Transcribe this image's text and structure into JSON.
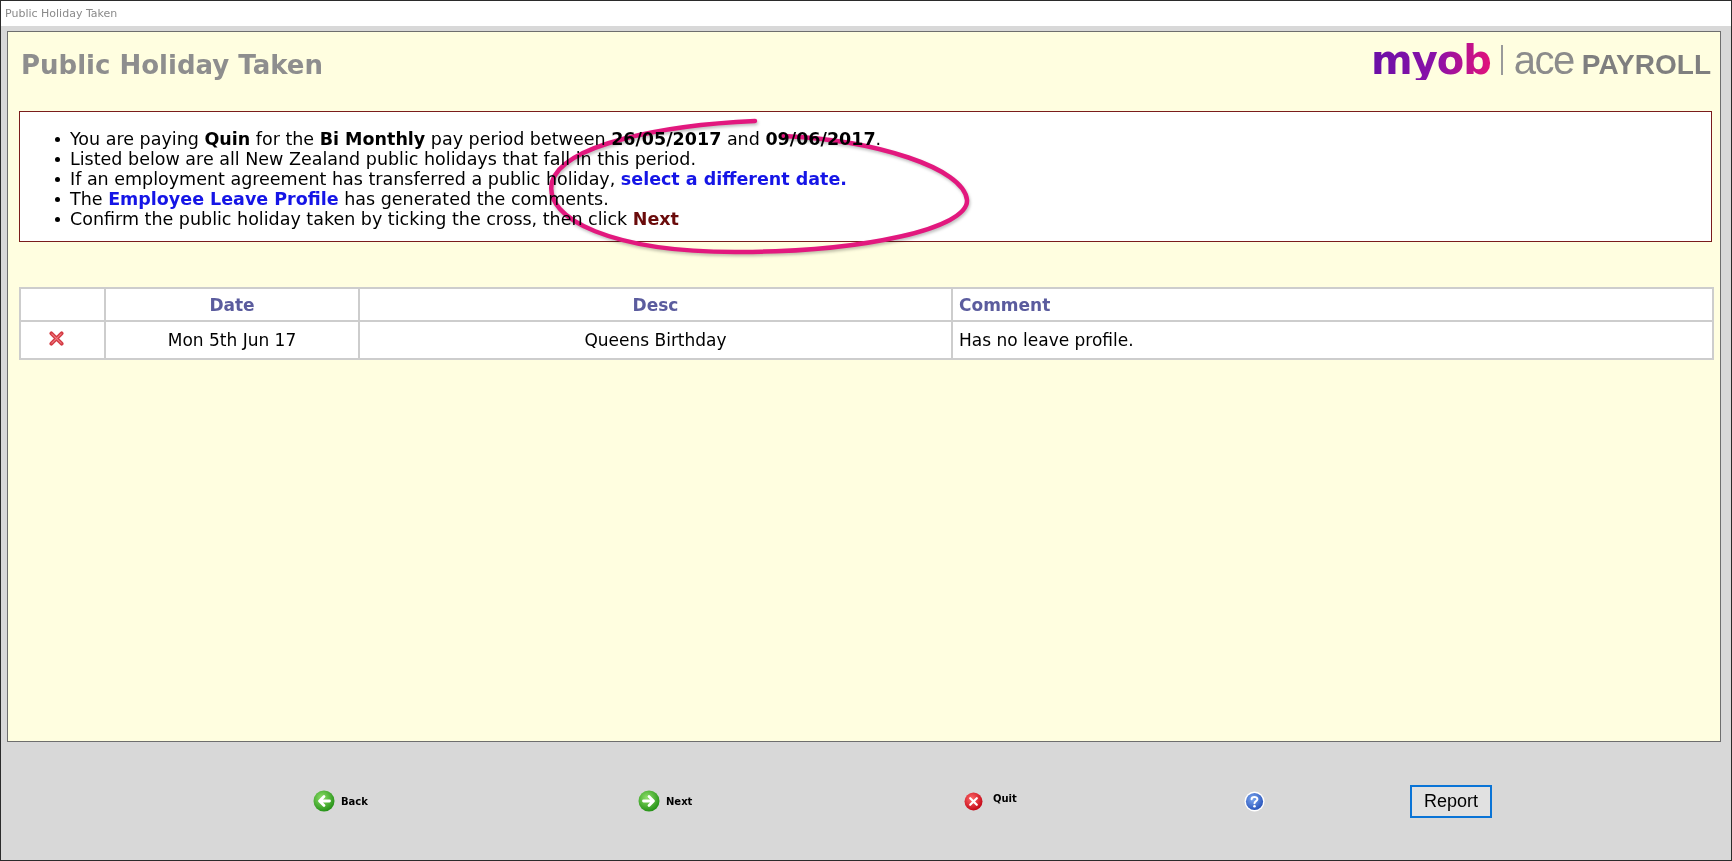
{
  "window": {
    "title": "Public Holiday Taken"
  },
  "header": {
    "heading": "Public Holiday Taken",
    "logo": {
      "brand": "myob",
      "product": "ace",
      "edition": "PAYROLL"
    }
  },
  "instructions": [
    {
      "segments": [
        {
          "kind": "text",
          "text": "You are paying **Quin** for the **Bi Monthly** pay period between **26/05/2017** and **09/06/2017**."
        }
      ]
    },
    {
      "segments": [
        {
          "kind": "text",
          "text": "Listed below are all New Zealand public holidays that fall in this period."
        }
      ]
    },
    {
      "segments": [
        {
          "kind": "text",
          "text": "If an employment agreement has transferred a public holiday, "
        },
        {
          "kind": "link",
          "text": "select a different date."
        }
      ]
    },
    {
      "segments": [
        {
          "kind": "text",
          "text": "The "
        },
        {
          "kind": "link",
          "text": "Employee Leave Profile"
        },
        {
          "kind": "text",
          "text": " has generated the comments."
        }
      ]
    },
    {
      "segments": [
        {
          "kind": "text",
          "text": "Confirm the public holiday taken by ticking the cross, then click "
        },
        {
          "kind": "emphasis",
          "text": "Next"
        }
      ]
    }
  ],
  "table": {
    "columns": [
      "Date",
      "Desc",
      "Comment"
    ],
    "rows": [
      {
        "checked": false,
        "date": "Mon 5th Jun 17",
        "desc": "Queens Birthday",
        "comment": "Has no leave profile."
      }
    ]
  },
  "footer": {
    "buttons": [
      {
        "kind": "back",
        "label": "Back"
      },
      {
        "kind": "next",
        "label": "Next"
      },
      {
        "kind": "quit",
        "label": "Quit"
      },
      {
        "kind": "help"
      },
      {
        "kind": "report",
        "label": "Report"
      }
    ]
  }
}
